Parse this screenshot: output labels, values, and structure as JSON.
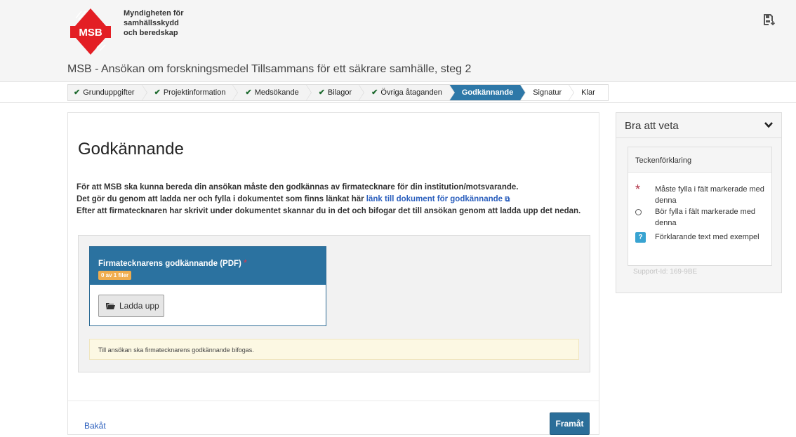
{
  "brand": {
    "logo_text": "MSB",
    "org_line1": "Myndigheten för",
    "org_line2": "samhällsskydd",
    "org_line3": "och beredskap",
    "color": "#e31e24"
  },
  "header": {
    "title": "MSB - Ansökan om forskningsmedel Tillsammans för ett säkrare samhälle, steg 2",
    "save_icon": "save-to-disk-icon"
  },
  "steps": [
    {
      "label": "Grunduppgifter",
      "done": true
    },
    {
      "label": "Projektinformation",
      "done": true
    },
    {
      "label": "Medsökande",
      "done": true
    },
    {
      "label": "Bilagor",
      "done": true
    },
    {
      "label": "Övriga åtaganden",
      "done": true
    },
    {
      "label": "Godkännande",
      "active": true
    },
    {
      "label": "Signatur"
    },
    {
      "label": "Klar"
    }
  ],
  "main": {
    "title": "Godkännande",
    "intro_line1": "För att MSB ska kunna bereda din ansökan måste den godkännas av firmatecknare för din institution/motsvarande.",
    "intro_line2_prefix": "Det gör du genom att ladda ner och fylla i dokumentet som finns länkat här",
    "intro_link": "länk till dokument för godkännande",
    "intro_line3": "Efter att firmatecknaren har skrivit under dokumentet skannar du in det och bifogar det till ansökan genom att ladda upp det nedan.",
    "upload": {
      "title": "Firmatecknarens godkännande (PDF)",
      "required_mark": "*",
      "file_count": "0 av 1 filer",
      "button_label": "Ladda upp"
    },
    "hint": "Till ansökan ska firmatecknarens godkännande bifogas.",
    "back_label": "Bakåt",
    "next_label": "Framåt"
  },
  "side": {
    "title": "Bra att veta",
    "legend_title": "Teckenförklaring",
    "legend": [
      {
        "symbol": "*",
        "text": "Måste fylla i fält markerade med denna"
      },
      {
        "symbol": "○",
        "text": "Bör fylla i fält markerade med denna"
      },
      {
        "symbol": "?",
        "text": "Förklarande text med exempel"
      }
    ],
    "support_id": "Support-Id: 169-9BE"
  },
  "colors": {
    "primary": "#2b72a0",
    "badge": "#f0ad4e",
    "required": "#e0364c",
    "link": "#2b5fbd"
  }
}
